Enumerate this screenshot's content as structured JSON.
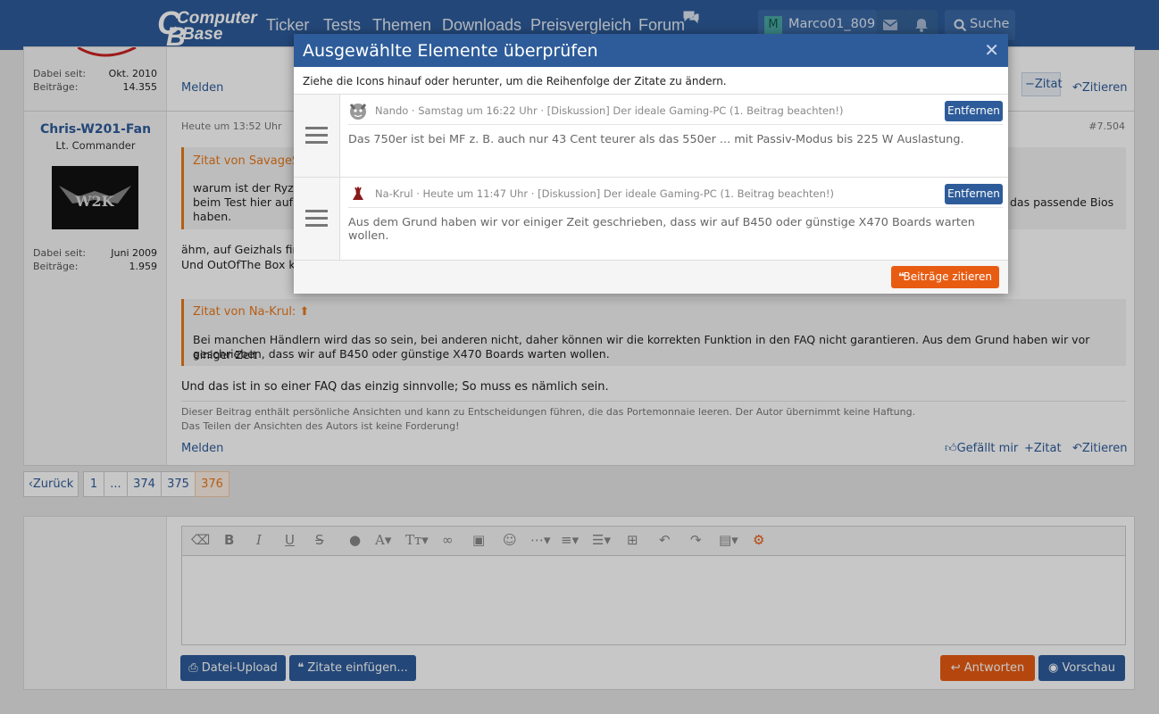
{
  "header": {
    "logo_top": "Computer",
    "logo_bottom": "Base",
    "nav": [
      "Ticker",
      "Tests",
      "Themen",
      "Downloads",
      "Preisvergleich",
      "Forum"
    ],
    "user": "Marco01_809",
    "search": "Suche"
  },
  "post1": {
    "joined_label": "Dabei seit:",
    "joined": "Okt. 2010",
    "posts_label": "Beiträge:",
    "posts": "14.355",
    "report": "Melden",
    "quote_toggle": "Zitat",
    "cite": "Zitieren"
  },
  "post2": {
    "author": "Chris-W201-Fan",
    "rank": "Lt. Commander",
    "joined_label": "Dabei seit:",
    "joined": "Juni 2009",
    "posts_label": "Beiträge:",
    "posts": "1.959",
    "time": "Heute um 13:52 Uhr",
    "number": "#7.504",
    "quote1": {
      "head": "Zitat von SavageSku",
      "line1": "warum ist der Ryzen",
      "line2": "beim Test hier auf C",
      "line3": "haben.",
      "tail": "das passende Bios"
    },
    "body1": "ähm, auf Geizhals fin",
    "body2": "Und OutOfThe Box k",
    "quote2": {
      "head": "Zitat von Na-Krul:",
      "line1": "Bei manchen Händlern wird das so sein, bei anderen nicht, daher können wir die korrekten Funktion in den FAQ nicht garantieren. Aus dem Grund haben wir vor einiger Zeit",
      "line2": "geschrieben, dass wir auf B450 oder günstige X470 Boards warten wollen."
    },
    "body3": "Und das ist in so einer FAQ das einzig sinnvolle; So muss es nämlich sein.",
    "sig1": "Dieser Beitrag enthält persönliche Ansichten und kann zu Entscheidungen führen, die das Portemonnaie leeren. Der Autor übernimmt keine Haftung.",
    "sig2": "Das Teilen der Ansichten des Autors ist keine Forderung!",
    "report": "Melden",
    "like": "Gefällt mir",
    "quote_toggle": "Zitat",
    "cite": "Zitieren"
  },
  "pagination": {
    "back": "Zurück",
    "pages": [
      "1",
      "...",
      "374",
      "375",
      "376"
    ]
  },
  "editor": {
    "upload": "Datei-Upload",
    "insert_quotes": "Zitate einfügen...",
    "reply": "Antworten",
    "preview": "Vorschau"
  },
  "modal": {
    "title": "Ausgewählte Elemente überprüfen",
    "description": "Ziehe die Icons hinauf oder herunter, um die Reihenfolge der Zitate zu ändern.",
    "items": [
      {
        "head": "Nando · Samstag um 16:22 Uhr · [Diskussion] Der ideale Gaming-PC (1. Beitrag beachten!)",
        "text": "Das 750er ist bei MF z. B. auch nur 43 Cent teurer als das 550er ... mit Passiv-Modus bis 225 W Auslastung.",
        "remove": "Entfernen"
      },
      {
        "head": "Na-Krul · Heute um 11:47 Uhr · [Diskussion] Der ideale Gaming-PC (1. Beitrag beachten!)",
        "text": "Aus dem Grund haben wir vor einiger Zeit geschrieben, dass wir auf B450 oder günstige X470 Boards warten wollen.",
        "remove": "Entfernen"
      }
    ],
    "submit": "Beiträge zitieren"
  },
  "colors": {
    "brand": "#2e5c9a",
    "accent": "#e85c12",
    "quote": "#e8791a"
  }
}
